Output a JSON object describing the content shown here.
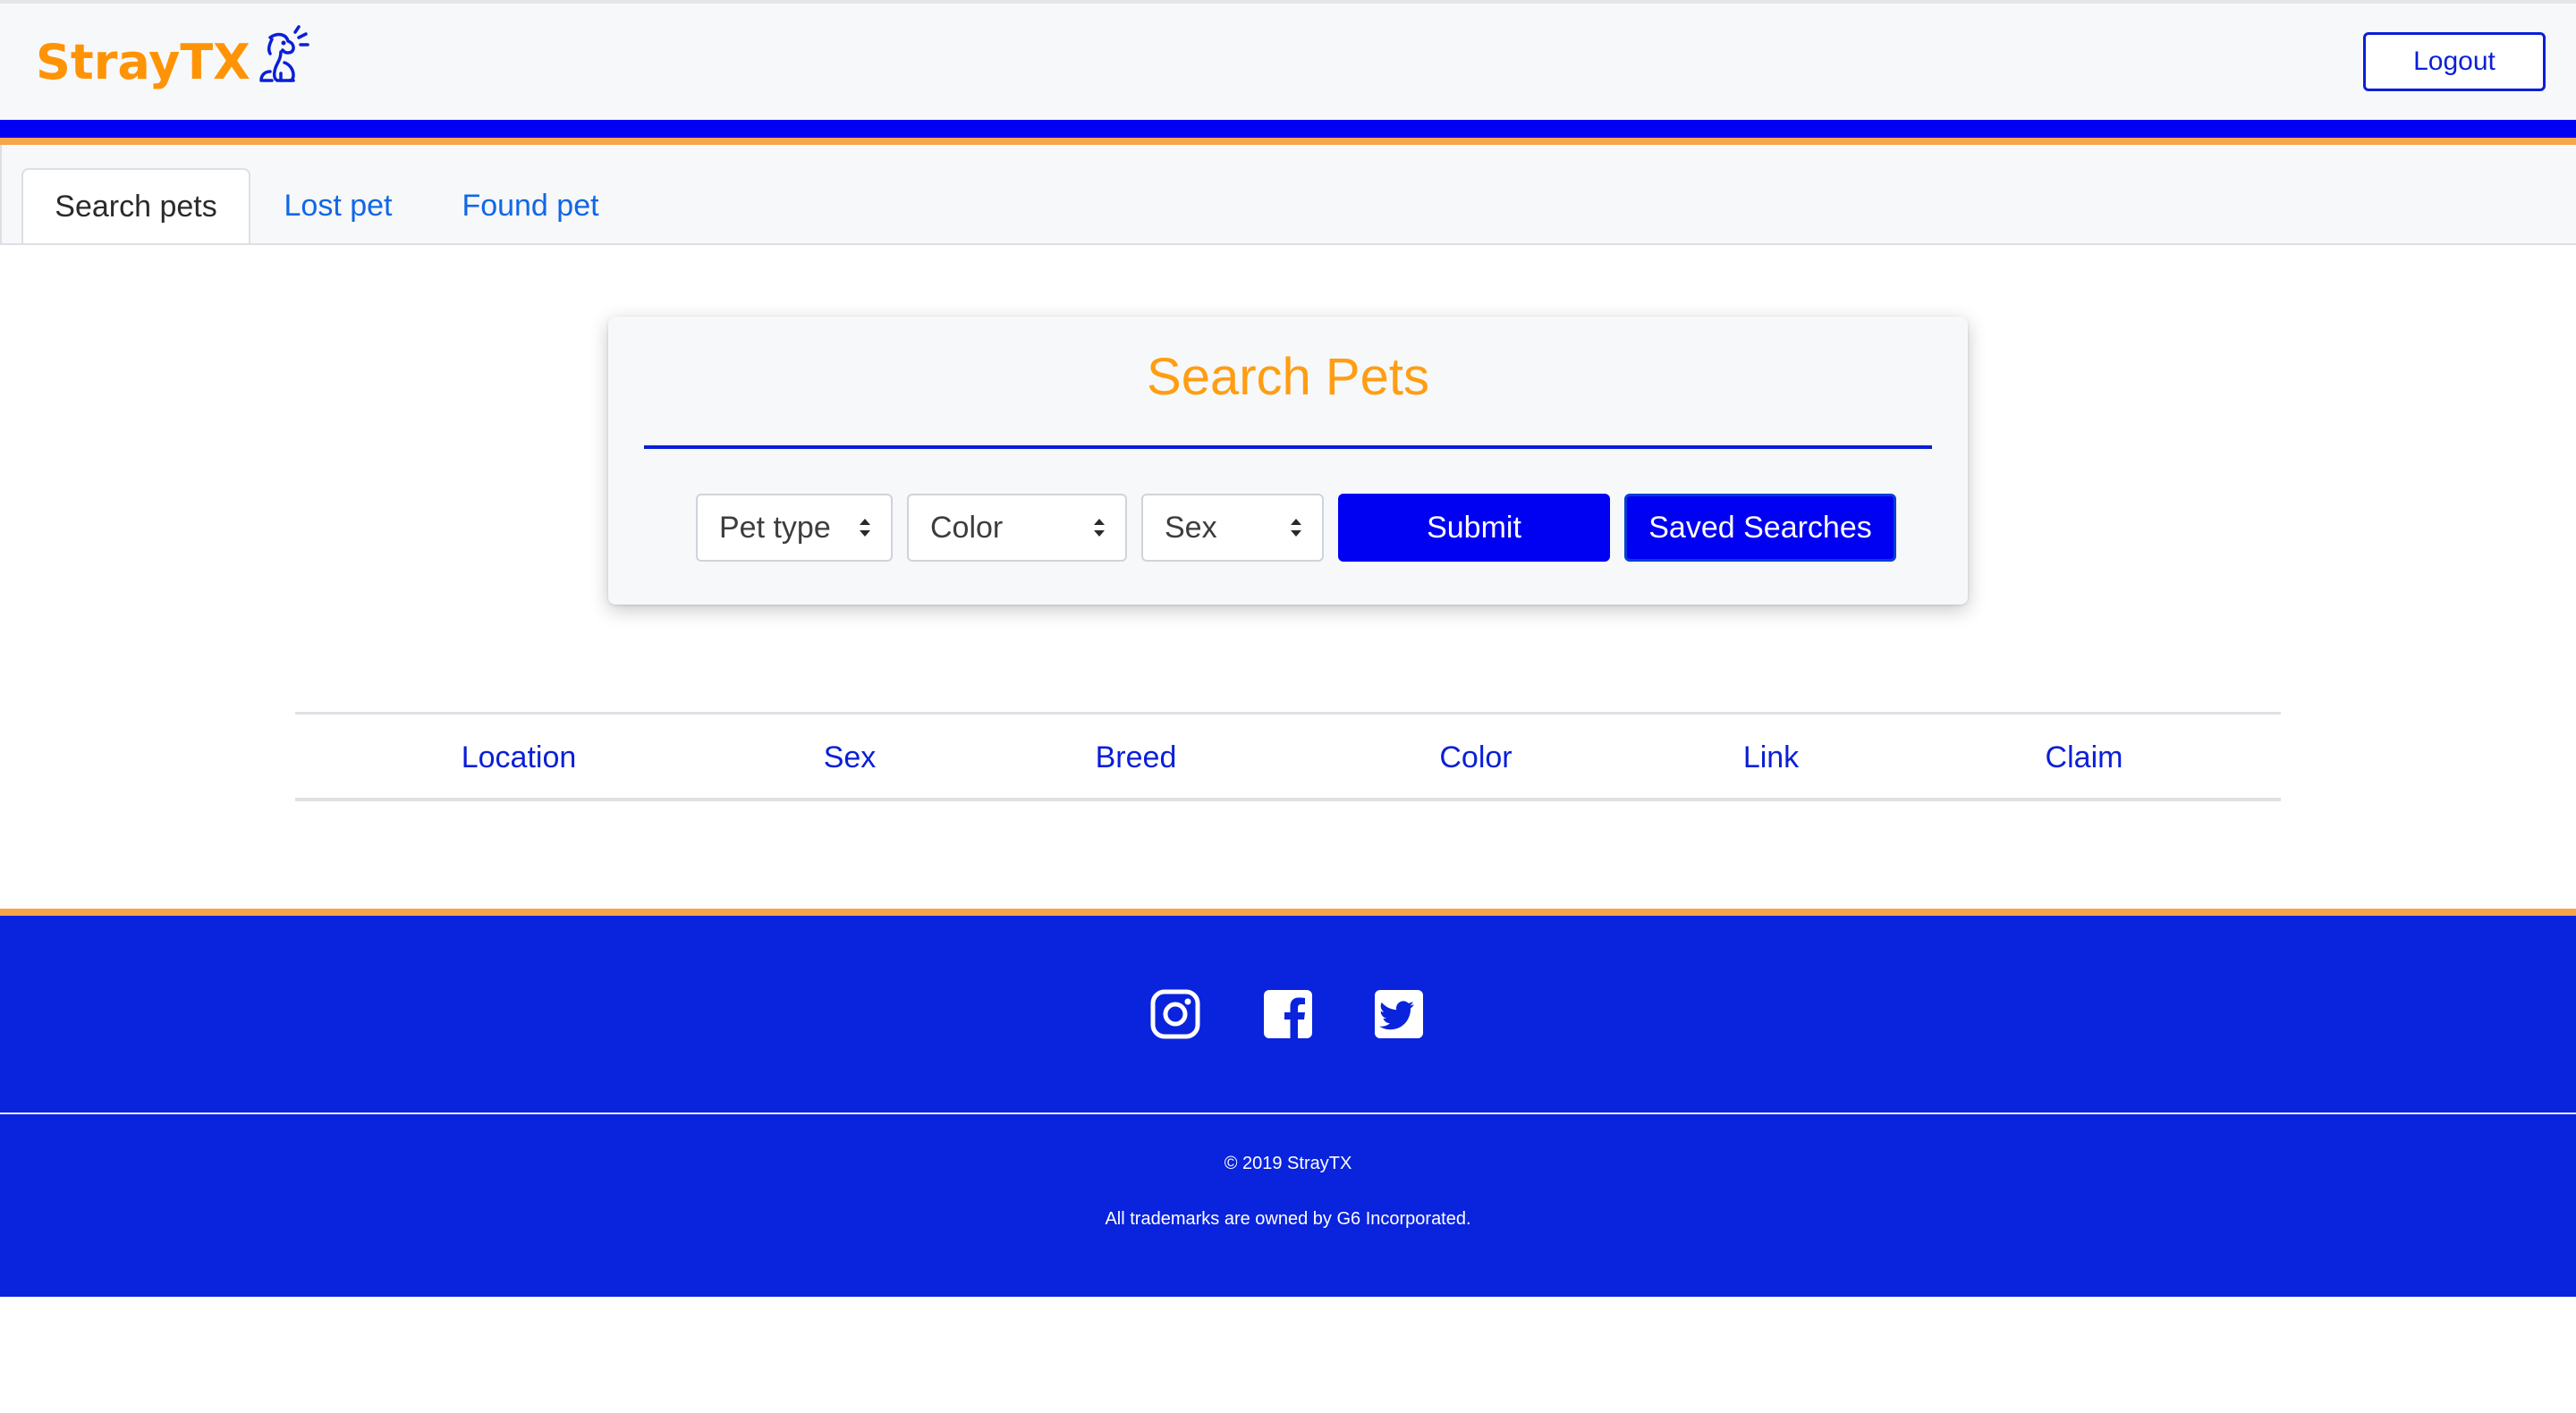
{
  "header": {
    "brand": "StrayTX",
    "brand_icon": "dog-icon",
    "logout_label": "Logout"
  },
  "tabs": [
    {
      "label": "Search pets",
      "active": true
    },
    {
      "label": "Lost pet",
      "active": false
    },
    {
      "label": "Found pet",
      "active": false
    }
  ],
  "search": {
    "title": "Search Pets",
    "pet_type": "Pet type",
    "color": "Color",
    "sex": "Sex",
    "submit_label": "Submit",
    "saved_label": "Saved Searches"
  },
  "table": {
    "headers": [
      "Location",
      "Sex",
      "Breed",
      "Color",
      "Link",
      "Claim"
    ]
  },
  "footer": {
    "social": [
      "instagram-icon",
      "facebook-icon",
      "twitter-icon"
    ],
    "copyright": "© 2019 StrayTX",
    "trademark": "All trademarks are owned by G6 Incorporated."
  },
  "colors": {
    "brand_orange": "#ff9306",
    "primary_blue": "#0000f2",
    "footer_blue": "#0a23dd"
  }
}
